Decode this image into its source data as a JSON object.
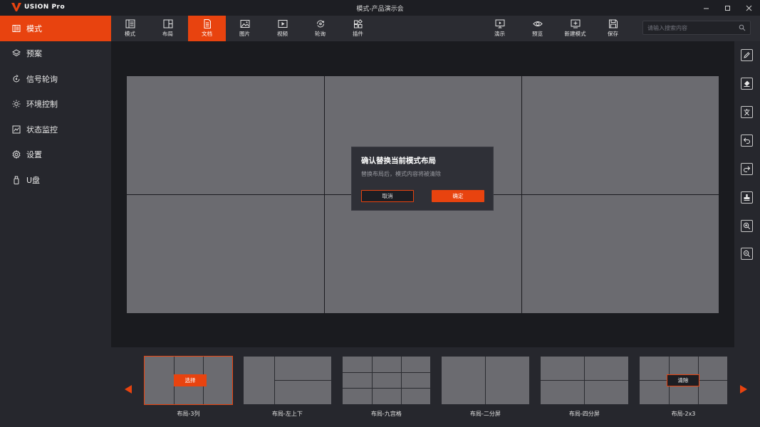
{
  "app": {
    "logo_text": "USION Pro",
    "window_title": "模式-产品演示会"
  },
  "sidebar": {
    "items": [
      {
        "label": "模式",
        "icon": "mode-icon",
        "active": true
      },
      {
        "label": "预案",
        "icon": "layers-icon",
        "active": false
      },
      {
        "label": "信号轮询",
        "icon": "signal-cycle-icon",
        "active": false
      },
      {
        "label": "环境控制",
        "icon": "sun-icon",
        "active": false
      },
      {
        "label": "状态监控",
        "icon": "monitor-chart-icon",
        "active": false
      },
      {
        "label": "设置",
        "icon": "gear-icon",
        "active": false
      },
      {
        "label": "U盘",
        "icon": "usb-icon",
        "active": false
      }
    ]
  },
  "toolbar": {
    "tools": [
      {
        "label": "模式",
        "icon": "mode-icon"
      },
      {
        "label": "布局",
        "icon": "layout-icon"
      },
      {
        "label": "文档",
        "icon": "document-icon",
        "active": true
      },
      {
        "label": "图片",
        "icon": "image-icon"
      },
      {
        "label": "视频",
        "icon": "video-icon"
      },
      {
        "label": "轮询",
        "icon": "cycle-icon"
      },
      {
        "label": "插件",
        "icon": "plugin-icon"
      }
    ],
    "right_tools": [
      {
        "label": "演示",
        "icon": "present-icon"
      },
      {
        "label": "预览",
        "icon": "eye-icon"
      },
      {
        "label": "新建模式",
        "icon": "new-mode-icon"
      },
      {
        "label": "保存",
        "icon": "save-icon"
      }
    ],
    "search_placeholder": "请输入搜索内容"
  },
  "rail": {
    "tools": [
      "pencil-icon",
      "eraser-icon",
      "text-icon",
      "undo-icon",
      "redo-icon",
      "stamp-icon",
      "zoom-in-icon",
      "zoom-out-icon"
    ]
  },
  "dialog": {
    "title": "确认替换当前模式布局",
    "message": "替换布局后，模式内容将被清除",
    "cancel_label": "取消",
    "ok_label": "确定"
  },
  "layouts": [
    {
      "label": "布局-3列",
      "button": "选择"
    },
    {
      "label": "布局-左上下",
      "button": ""
    },
    {
      "label": "布局-九宫格",
      "button": ""
    },
    {
      "label": "布局-二分屏",
      "button": ""
    },
    {
      "label": "布局-四分屏",
      "button": ""
    },
    {
      "label": "布局-2x3",
      "button": "清除"
    }
  ],
  "colors": {
    "accent": "#e8430f",
    "sidebar_bg": "#26272d",
    "canvas_cell": "#6b6b70"
  }
}
